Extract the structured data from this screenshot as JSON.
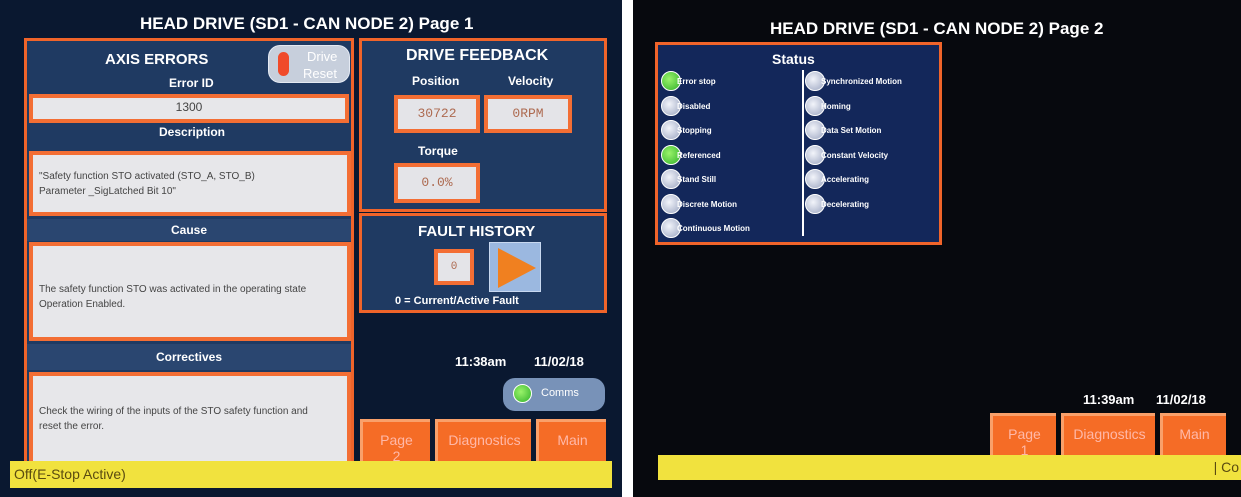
{
  "page1": {
    "title": "HEAD DRIVE (SD1 - CAN NODE 2) Page 1",
    "axis_errors": {
      "title": "AXIS ERRORS",
      "drive_reset_label_1": "Drive",
      "drive_reset_label_2": "Reset",
      "error_id_label": "Error ID",
      "error_id_value": "1300",
      "description_label": "Description",
      "description_line1": "\"Safety function STO activated (STO_A, STO_B)",
      "description_line2": "Parameter _SigLatched Bit 10\"",
      "cause_label": "Cause",
      "cause_line1": "The safety function STO was activated in the operating state",
      "cause_line2": "Operation Enabled.",
      "correctives_label": "Correctives",
      "correctives_line1": "Check the wiring of the inputs of the STO safety function and",
      "correctives_line2": "reset the error."
    },
    "drive_feedback": {
      "title": "DRIVE FEEDBACK",
      "position_label": "Position",
      "velocity_label": "Velocity",
      "position_value": "30722",
      "velocity_value": "0RPM",
      "torque_label": "Torque",
      "torque_value": "0.0%"
    },
    "fault_history": {
      "title": "FAULT HISTORY",
      "index_value": "0",
      "note": "0 = Current/Active Fault"
    },
    "time": "11:38am",
    "date": "11/02/18",
    "comms_label": "Comms",
    "nav": {
      "page_label": "Page",
      "page_number": "2",
      "diagnostics_label": "Diagnostics",
      "main_label": "Main"
    },
    "status_bar": "Off(E-Stop Active)",
    "colors": {
      "accent": "#f0642a",
      "panel": "#1f3a62",
      "status_bar": "#f1e23e",
      "led_on": "#3cc43a"
    }
  },
  "page2": {
    "title": "HEAD DRIVE (SD1 - CAN NODE 2) Page 2",
    "status_title": "Status",
    "left_items": [
      {
        "label": "Error stop",
        "state": "on"
      },
      {
        "label": "Disabled",
        "state": "off"
      },
      {
        "label": "Stopping",
        "state": "off"
      },
      {
        "label": "Referenced",
        "state": "on"
      },
      {
        "label": "Stand Still",
        "state": "off"
      },
      {
        "label": "Discrete Motion",
        "state": "off"
      },
      {
        "label": "Continuous Motion",
        "state": "off"
      }
    ],
    "right_items": [
      {
        "label": "Synchronized Motion",
        "state": "off"
      },
      {
        "label": "Homing",
        "state": "off"
      },
      {
        "label": "Data Set Motion",
        "state": "off"
      },
      {
        "label": "Constant Velocity",
        "state": "off"
      },
      {
        "label": "Accelerating",
        "state": "off"
      },
      {
        "label": "Decelerating",
        "state": "off"
      }
    ],
    "time": "11:39am",
    "date": "11/02/18",
    "nav": {
      "page_label": "Page",
      "page_number": "1",
      "diagnostics_label": "Diagnostics",
      "main_label": "Main"
    },
    "status_bar": "| Co"
  }
}
